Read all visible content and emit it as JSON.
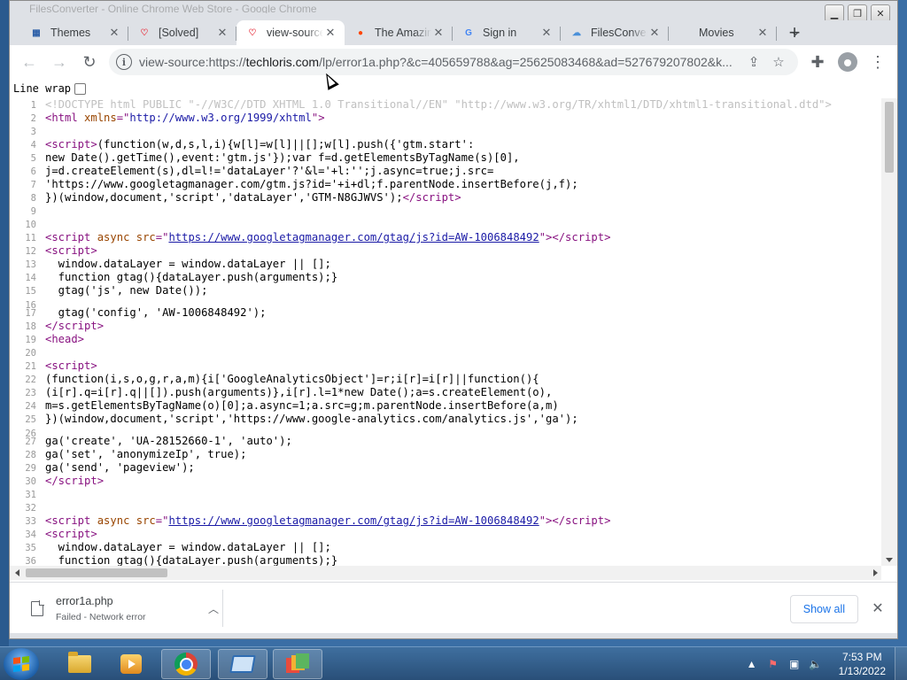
{
  "browser": {
    "window_title": "FilesConverter - Online Chrome Web Store - Google Chrome",
    "tabs": [
      {
        "title": "Themes",
        "favicon": "themes-favicon",
        "color": "#2b5ea7",
        "glyph": "▦",
        "active": false
      },
      {
        "title": "[Solved]",
        "favicon": "heart-favicon",
        "color": "#e8434f",
        "glyph": "♡",
        "active": false
      },
      {
        "title": "view-source",
        "favicon": "heart-favicon",
        "color": "#e8434f",
        "glyph": "♡",
        "active": true
      },
      {
        "title": "The Amazing",
        "favicon": "reddit-favicon",
        "color": "#ff4500",
        "glyph": "●",
        "active": false
      },
      {
        "title": "Sign in",
        "favicon": "google-favicon",
        "color": "#4285f4",
        "glyph": "G",
        "active": false
      },
      {
        "title": "FilesConverter",
        "favicon": "cloud-favicon",
        "color": "#4a90d9",
        "glyph": "☁",
        "active": false
      },
      {
        "title": "Movies",
        "favicon": "none",
        "color": "#ffffff",
        "glyph": "",
        "active": false
      }
    ],
    "url_prefix": "view-source:https://",
    "url_host": "techloris.com",
    "url_rest": "/lp/error1a.php?&c=405659788&ag=25625083468&ad=527679207802&k..."
  },
  "page": {
    "line_wrap_label": "Line wrap",
    "source_lines": [
      {
        "n": "1",
        "html": "<span class=\"t-doc\">&lt;!DOCTYPE html PUBLIC \"-//W3C//DTD XHTML 1.0 Transitional//EN\" \"http://www.w3.org/TR/xhtml1/DTD/xhtml1-transitional.dtd\"&gt;</span>"
      },
      {
        "n": "2",
        "html": "<span class=\"t-tag\">&lt;html</span> <span class=\"t-attr\">xmlns</span><span class=\"t-tag\">=\"</span><span class=\"t-val\">http://www.w3.org/1999/xhtml</span><span class=\"t-tag\">\"&gt;</span>"
      },
      {
        "n": "3",
        "html": ""
      },
      {
        "n": "4",
        "html": "<span class=\"t-tag\">&lt;script&gt;</span>(function(w,d,s,l,i){w[l]=w[l]||[];w[l].push({'gtm.start':"
      },
      {
        "n": "5",
        "html": "new Date().getTime(),event:'gtm.js'});var f=d.getElementsByTagName(s)[0],"
      },
      {
        "n": "6",
        "html": "j=d.createElement(s),dl=l!='dataLayer'?'&amp;l='+l:'';j.async=true;j.src="
      },
      {
        "n": "7",
        "html": "'https://www.googletagmanager.com/gtm.js?id='+i+dl;f.parentNode.insertBefore(j,f);"
      },
      {
        "n": "8",
        "html": "})(window,document,'script','dataLayer','GTM-N8GJWVS');<span class=\"t-tag\">&lt;/script&gt;</span>"
      },
      {
        "n": "9",
        "html": ""
      },
      {
        "n": "10",
        "html": ""
      },
      {
        "n": "11",
        "html": "<span class=\"t-tag\">&lt;script</span> <span class=\"t-attr\">async src</span><span class=\"t-tag\">=\"</span><span class=\"t-link\">https://www.googletagmanager.com/gtag/js?id=AW-1006848492</span><span class=\"t-tag\">\"&gt;&lt;/script&gt;</span>"
      },
      {
        "n": "12",
        "html": "<span class=\"t-tag\">&lt;script&gt;</span>"
      },
      {
        "n": "13",
        "html": "  window.dataLayer = window.dataLayer || [];"
      },
      {
        "n": "14",
        "html": "  function gtag(){dataLayer.push(arguments);}"
      },
      {
        "n": "15",
        "html": "  gtag('js', new Date());"
      },
      {
        "n": "16",
        "html": ""
      },
      {
        "n": "17",
        "html": "  gtag('config', 'AW-1006848492');"
      },
      {
        "n": "18",
        "html": "<span class=\"t-tag\">&lt;/script&gt;</span>"
      },
      {
        "n": "19",
        "html": "<span class=\"t-tag\">&lt;head&gt;</span>"
      },
      {
        "n": "20",
        "html": ""
      },
      {
        "n": "21",
        "html": "<span class=\"t-tag\">&lt;script&gt;</span>"
      },
      {
        "n": "22",
        "html": "(function(i,s,o,g,r,a,m){i['GoogleAnalyticsObject']=r;i[r]=i[r]||function(){"
      },
      {
        "n": "23",
        "html": "(i[r].q=i[r].q||[]).push(arguments)},i[r].l=1*new Date();a=s.createElement(o),"
      },
      {
        "n": "24",
        "html": "m=s.getElementsByTagName(o)[0];a.async=1;a.src=g;m.parentNode.insertBefore(a,m)"
      },
      {
        "n": "25",
        "html": "})(window,document,'script','https://www.google-analytics.com/analytics.js','ga');"
      },
      {
        "n": "26",
        "html": ""
      },
      {
        "n": "27",
        "html": "ga('create', 'UA-28152660-1', 'auto');"
      },
      {
        "n": "28",
        "html": "ga('set', 'anonymizeIp', true);"
      },
      {
        "n": "29",
        "html": "ga('send', 'pageview');"
      },
      {
        "n": "30",
        "html": "<span class=\"t-tag\">&lt;/script&gt;</span>"
      },
      {
        "n": "31",
        "html": ""
      },
      {
        "n": "32",
        "html": ""
      },
      {
        "n": "33",
        "html": "<span class=\"t-tag\">&lt;script</span> <span class=\"t-attr\">async src</span><span class=\"t-tag\">=\"</span><span class=\"t-link\">https://www.googletagmanager.com/gtag/js?id=AW-1006848492</span><span class=\"t-tag\">\"&gt;&lt;/script&gt;</span>"
      },
      {
        "n": "34",
        "html": "<span class=\"t-tag\">&lt;script&gt;</span>"
      },
      {
        "n": "35",
        "html": "  window.dataLayer = window.dataLayer || [];"
      },
      {
        "n": "36",
        "html": "  function gtag(){dataLayer.push(arguments);}"
      }
    ]
  },
  "download_shelf": {
    "file_name": "error1a.php",
    "status": "Failed - Network error",
    "show_all_label": "Show all"
  },
  "taskbar": {
    "time": "7:53 PM",
    "date": "1/13/2022"
  }
}
